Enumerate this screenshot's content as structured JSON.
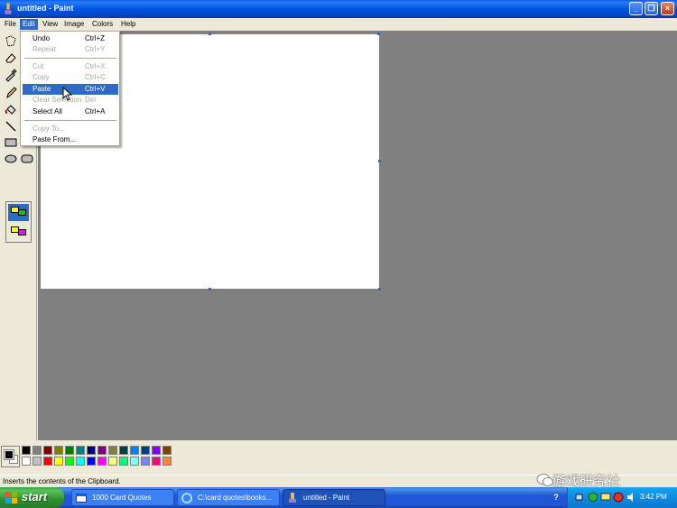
{
  "window": {
    "title": "untitled - Paint"
  },
  "menubar": [
    "File",
    "Edit",
    "View",
    "Image",
    "Colors",
    "Help"
  ],
  "edit_menu": {
    "items": [
      {
        "label": "Undo",
        "shortcut": "Ctrl+Z",
        "state": "enabled"
      },
      {
        "label": "Repeat",
        "shortcut": "Ctrl+Y",
        "state": "disabled"
      },
      {
        "label": "Cut",
        "shortcut": "Ctrl+X",
        "state": "disabled"
      },
      {
        "label": "Copy",
        "shortcut": "Ctrl+C",
        "state": "disabled"
      },
      {
        "label": "Paste",
        "shortcut": "Ctrl+V",
        "state": "highlighted"
      },
      {
        "label": "Clear Selection",
        "shortcut": "Del",
        "state": "disabled"
      },
      {
        "label": "Select All",
        "shortcut": "Ctrl+A",
        "state": "enabled"
      },
      {
        "label": "Copy To...",
        "shortcut": "",
        "state": "disabled"
      },
      {
        "label": "Paste From...",
        "shortcut": "",
        "state": "enabled"
      }
    ]
  },
  "palette": {
    "row1": [
      "#000000",
      "#808080",
      "#800000",
      "#808000",
      "#008000",
      "#008080",
      "#000080",
      "#800080",
      "#808040",
      "#004040",
      "#0080ff",
      "#004080",
      "#8000ff",
      "#804000"
    ],
    "row2": [
      "#ffffff",
      "#c0c0c0",
      "#ff0000",
      "#ffff00",
      "#00ff00",
      "#00ffff",
      "#0000ff",
      "#ff00ff",
      "#ffff80",
      "#00ff80",
      "#80ffff",
      "#8080ff",
      "#ff0080",
      "#ff8040"
    ]
  },
  "status": {
    "text": "Inserts the contents of the Clipboard."
  },
  "watermark": {
    "text": "游戏研究社"
  },
  "taskbar": {
    "start_label": "start",
    "tasks": [
      "1000 Card Quotes",
      "C:\\card quotes\\books...",
      "untitled - Paint"
    ],
    "clock": "3:42 PM"
  }
}
